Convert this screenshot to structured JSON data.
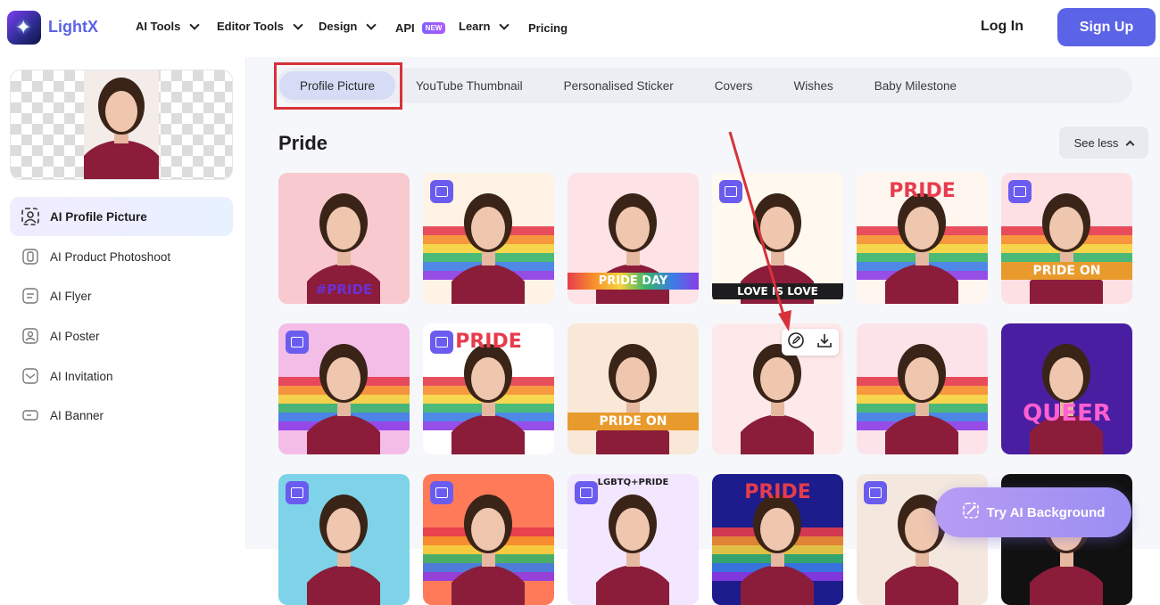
{
  "header": {
    "brand": "LightX",
    "nav": [
      {
        "label": "AI Tools",
        "has_menu": true
      },
      {
        "label": "Editor Tools",
        "has_menu": true
      },
      {
        "label": "Design",
        "has_menu": true
      },
      {
        "label": "API",
        "badge": "NEW",
        "has_menu": false
      },
      {
        "label": "Learn",
        "has_menu": true
      },
      {
        "label": "Pricing",
        "has_menu": false
      }
    ],
    "login_label": "Log In",
    "signup_label": "Sign Up"
  },
  "sidebar": {
    "items": [
      {
        "label": "AI Profile Picture",
        "icon": "profile-picture-icon",
        "active": true
      },
      {
        "label": "AI Product Photoshoot",
        "icon": "product-photoshoot-icon",
        "active": false
      },
      {
        "label": "AI Flyer",
        "icon": "flyer-icon",
        "active": false
      },
      {
        "label": "AI Poster",
        "icon": "poster-icon",
        "active": false
      },
      {
        "label": "AI Invitation",
        "icon": "invitation-icon",
        "active": false
      },
      {
        "label": "AI Banner",
        "icon": "banner-icon",
        "active": false
      }
    ]
  },
  "main": {
    "tabs": [
      {
        "label": "Profile Picture",
        "active": true
      },
      {
        "label": "YouTube Thumbnail",
        "active": false
      },
      {
        "label": "Personalised Sticker",
        "active": false
      },
      {
        "label": "Covers",
        "active": false
      },
      {
        "label": "Wishes",
        "active": false
      },
      {
        "label": "Baby Milestone",
        "active": false
      }
    ],
    "section_title": "Pride",
    "see_less_label": "See less",
    "templates": [
      {
        "text": "#PRIDE",
        "badge": false
      },
      {
        "text": "",
        "badge": true
      },
      {
        "text": "PRIDE DAY",
        "badge": false
      },
      {
        "text": "LOVE IS LOVE",
        "badge": true
      },
      {
        "text": "PRIDE",
        "badge": false
      },
      {
        "text": "PRIDE ON",
        "badge": true
      },
      {
        "text": "",
        "badge": true
      },
      {
        "text": "PRIDE",
        "badge": true
      },
      {
        "text": "PRIDE ON",
        "badge": false
      },
      {
        "text": "",
        "badge": false
      },
      {
        "text": "",
        "badge": false
      },
      {
        "text": "QUEER",
        "badge": false
      },
      {
        "text": "",
        "badge": true
      },
      {
        "text": "",
        "badge": true
      },
      {
        "text": "LGBTQ+PRIDE",
        "badge": true
      },
      {
        "text": "PRIDE",
        "badge": false
      },
      {
        "text": "",
        "badge": true
      },
      {
        "text": "",
        "badge": false
      }
    ],
    "try_button_label": "Try AI Background"
  },
  "colors": {
    "accent": "#5b63e6",
    "highlight": "#d7323a",
    "shirt": "#8b1d3a"
  }
}
